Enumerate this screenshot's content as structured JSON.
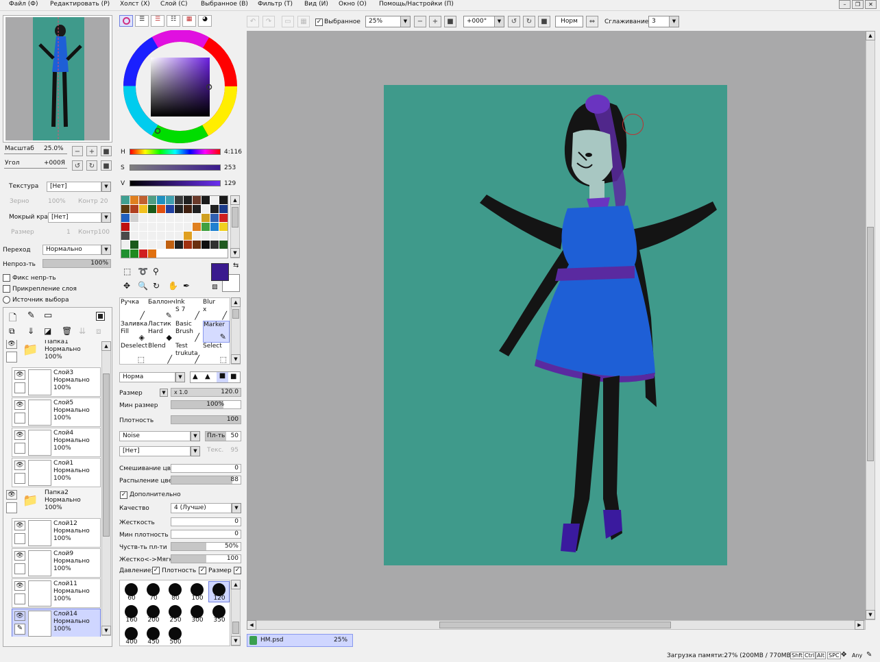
{
  "menubar": {
    "items": [
      "Файл (Ф)",
      "Редактировать (Р)",
      "Холст (Х)",
      "Слой (С)",
      "Выбранное (В)",
      "Фильтр (Т)",
      "Вид (И)",
      "Окно (О)",
      "Помощь/Настройки (П)"
    ]
  },
  "toolbar": {
    "favorites_label": "Выбранное",
    "zoom": "25%",
    "angle": "+000°",
    "blend": "Норм",
    "smoothing_label": "Сглаживание",
    "smoothing_value": "3"
  },
  "navigator": {
    "scale_label": "Масштаб",
    "scale_value": "25.0%",
    "angle_label": "Угол",
    "angle_value": "+000Я"
  },
  "texture": {
    "label": "Текстура",
    "value": "[Нет]",
    "grain_label": "Зерно",
    "grain_value": "100%",
    "contrast_label": "Контр",
    "contrast_value": "20"
  },
  "wet_edge": {
    "label": "Мокрый край",
    "value": "[Нет]",
    "size_label": "Размер",
    "size_value": "1",
    "contrast_value": "Контр100"
  },
  "blending": {
    "label": "Переход",
    "value": "Нормально",
    "opacity_label": "Непроз-ть",
    "opacity_value": "100%",
    "opacity_fraction": 1.0
  },
  "options": {
    "fix_opacity": "Фикс непр-ть",
    "clip_layer": "Прикрепление слоя",
    "selection_source": "Источник выбора"
  },
  "layers": [
    {
      "name": "Папка1",
      "mode": "Нормально",
      "opacity": "100%",
      "folder": true
    },
    {
      "name": "Слой3",
      "mode": "Нормально",
      "opacity": "100%"
    },
    {
      "name": "Слой5",
      "mode": "Нормально",
      "opacity": "100%"
    },
    {
      "name": "Слой4",
      "mode": "Нормально",
      "opacity": "100%"
    },
    {
      "name": "Слой1",
      "mode": "Нормально",
      "opacity": "100%"
    },
    {
      "name": "Папка2",
      "mode": "Нормально",
      "opacity": "100%",
      "folder": true
    },
    {
      "name": "Слой12",
      "mode": "Нормально",
      "opacity": "100%"
    },
    {
      "name": "Слой9",
      "mode": "Нормально",
      "opacity": "100%"
    },
    {
      "name": "Слой11",
      "mode": "Нормально",
      "opacity": "100%"
    },
    {
      "name": "Слой14",
      "mode": "Нормально",
      "opacity": "100%",
      "selected": true
    }
  ],
  "color": {
    "h_label": "H",
    "h_value": "4:116",
    "s_label": "S",
    "s_value": "253",
    "v_label": "V",
    "v_value": "129",
    "primary": "#3a1a8e",
    "secondary": "#ffffff"
  },
  "swatches": [
    "#3fa091",
    "#e08020",
    "#c06030",
    "#4f9e84",
    "#2090c0",
    "#40a0b0",
    "#3a3a3a",
    "#202020",
    "#6a3a2a",
    "#1a1a1a",
    "#f0f0f0",
    "#1a1a1a",
    "#5a3a10",
    "#b04020",
    "#f0c020",
    "#1a5a1a",
    "#e05010",
    "#2040a0",
    "#202020",
    "#402010",
    "#202020",
    "#f0f0f0",
    "#202020",
    "#1a3a8a",
    "#2060c0",
    "#d0d0d0",
    "#f0f0f0",
    "#f0f0f0",
    "#f0f0f0",
    "#f0f0f0",
    "#f0f0f0",
    "#f0f0f0",
    "#f0f0f0",
    "#d0a020",
    "#3060b0",
    "#d02020",
    "#c01010",
    "#f0f0f0",
    "#f0f0f0",
    "#f0f0f0",
    "#f0f0f0",
    "#f0f0f0",
    "#f0f0f0",
    "#f0f0f0",
    "#e08020",
    "#40a040",
    "#2080d0",
    "#f0d020",
    "#4a4a4a",
    "#f0f0f0",
    "#f0f0f0",
    "#f0f0f0",
    "#f0f0f0",
    "#f0f0f0",
    "#f0f0f0",
    "#e0a020",
    "#f0f0f0",
    "#f0f0f0",
    "#f0f0f0",
    "#f0f0f0",
    "#f0f0f0",
    "#1a5a1a",
    "#f0f0f0",
    "#f0f0f0",
    "#f0f0f0",
    "#c06010",
    "#202020",
    "#a03010",
    "#6a3010",
    "#101010",
    "#303030",
    "#205a20",
    "#209030",
    "#208a20",
    "#d02020",
    "#e07010"
  ],
  "brushes": [
    {
      "l1": "Ручка",
      "l2": ""
    },
    {
      "l1": "Баллонч",
      "l2": ""
    },
    {
      "l1": "Ink",
      "l2": "S 7"
    },
    {
      "l1": "Blur",
      "l2": "x"
    },
    {
      "l1": "Заливка",
      "l2": "Fill"
    },
    {
      "l1": "Ластик",
      "l2": "Hard"
    },
    {
      "l1": "Basic",
      "l2": "Brush"
    },
    {
      "l1": "Marker",
      "l2": "",
      "selected": true
    },
    {
      "l1": "Deselect",
      "l2": ""
    },
    {
      "l1": "Blend",
      "l2": ""
    },
    {
      "l1": "Test",
      "l2": "trukuta"
    },
    {
      "l1": "Select",
      "l2": ""
    }
  ],
  "tool": {
    "mode": "Норма",
    "size_label": "Размер",
    "size_mult": "x 1.0",
    "size_value": "120.0",
    "min_size_label": "Мин размер",
    "min_size_value": "100%",
    "density_label": "Плотность",
    "density_value": "100",
    "shape": "Noise",
    "shape_strength_label": "Пл-ть",
    "shape_strength_value": "50",
    "texture": "[Нет]",
    "texture_strength_label": "Текс.",
    "texture_strength_value": "95",
    "color_mix_label": "Смешивание цвет",
    "color_mix_value": "0",
    "color_spray_label": "Распыление цвет",
    "color_spray_value": "88",
    "advanced_label": "Дополнительно",
    "quality_label": "Качество",
    "quality_value": "4 (Лучше)",
    "hardness_label": "Жесткость",
    "hardness_value": "0",
    "min_density_label": "Мин плотность",
    "min_density_value": "0",
    "sensitivity_label": "Чуств-ть пл-ти",
    "sensitivity_value": "50%",
    "hard_soft_label": "Жестко<->Мягко",
    "hard_soft_value": "100",
    "pressure_label": "Давление:",
    "pressure_density": "Плотность",
    "pressure_size": "Размер"
  },
  "brush_sizes": [
    "60",
    "70",
    "80",
    "100",
    "120",
    "160",
    "200",
    "250",
    "300",
    "350",
    "400",
    "450",
    "500"
  ],
  "document": {
    "name": "HM.psd",
    "zoom": "25%"
  },
  "status": {
    "memory": "Загрузка памяти:27% (200MB / 770MB)",
    "keys": [
      "Shft",
      "Ctrl",
      "Alt",
      "SPC"
    ],
    "any": "Any"
  }
}
